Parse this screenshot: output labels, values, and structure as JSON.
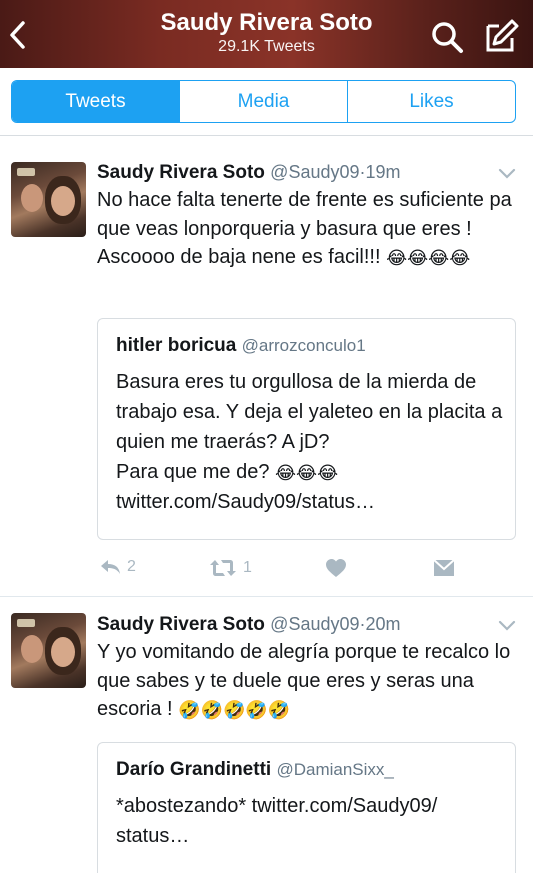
{
  "header": {
    "title": "Saudy Rivera Soto",
    "subtitle": "29.1K Tweets",
    "back_icon": "chevron-left-icon",
    "search_icon": "search-icon",
    "compose_icon": "compose-icon",
    "bg_color": "#7a2b22"
  },
  "tabs": [
    {
      "label": "Tweets",
      "active": true
    },
    {
      "label": "Media",
      "active": false
    },
    {
      "label": "Likes",
      "active": false
    }
  ],
  "accent": "#1da1f2",
  "tweets": [
    {
      "name": "Saudy Rivera Soto",
      "handle": "@Saudy09",
      "dot": "·",
      "time": "19m",
      "text": "No hace falta tenerte de frente es suficiente pa que veas lonporqueria y basura que eres ! Ascoooo de baja nene es facil!!!",
      "emojis": "😂😂😂😂",
      "quote": {
        "name": "hitler boricua",
        "handle": "@arrozconculo1",
        "text": "Basura eres tu orgullosa de la mierda de trabajo esa. Y deja el yaleteo en la placita a quien me traerás? A jD?",
        "line2_prefix": "Para que me de?",
        "emojis": "😂😂😂",
        "link": "twitter.com/Saudy09/status…"
      },
      "actions": {
        "reply_count": "2",
        "retweet_count": "1"
      }
    },
    {
      "name": "Saudy Rivera Soto",
      "handle": "@Saudy09",
      "dot": "·",
      "time": "20m",
      "text": "Y yo vomitando de alegría porque te recalco lo que sabes y te duele que eres y seras una escoria !",
      "emojis": "🤣🤣🤣🤣🤣",
      "quote": {
        "name": "Darío Grandinetti",
        "handle": "@DamianSixx_",
        "text": "*abostezando* twitter.com/Saudy09/ status…"
      }
    }
  ]
}
